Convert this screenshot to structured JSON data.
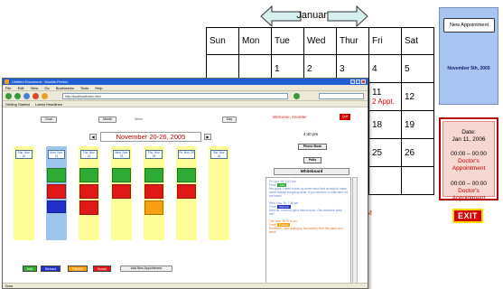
{
  "calendar": {
    "month": "January",
    "weekdays": [
      "Sun",
      "Mon",
      "Tue",
      "Wed",
      "Thur",
      "Fri",
      "Sat"
    ],
    "rows": [
      [
        "",
        "",
        "1",
        "2",
        "3",
        "4",
        "5"
      ],
      [
        "",
        "",
        "",
        "",
        "",
        "11",
        "12"
      ],
      [
        "",
        "",
        "",
        "",
        "",
        "18",
        "19"
      ],
      [
        "",
        "",
        "",
        "",
        "",
        "25",
        "26"
      ],
      [
        "",
        "",
        "",
        "",
        "",
        "",
        ""
      ]
    ],
    "appt_note": "2 Appt.",
    "cut_text": "M"
  },
  "panel_blue": {
    "new_appt_label": "New Appointment",
    "date": "November 5th, 2005"
  },
  "panel_red": {
    "date_label": "Date:",
    "date_value": "Jan 11, 2006",
    "appointments": [
      {
        "time": "00:00 – 00:00",
        "title": "Doctor's Appointment"
      },
      {
        "time": "00:00 – 00:00",
        "title": "Doctor's Appointment"
      }
    ]
  },
  "exit_label": "EXIT",
  "browser": {
    "title": "Untitled Document - Mozilla Firefox",
    "menu": [
      "File",
      "Edit",
      "View",
      "Go",
      "Bookmarks",
      "Tools",
      "Help"
    ],
    "url": "http://localhost/index.html",
    "bookmarks": [
      "Getting Started",
      "Latest Headlines"
    ],
    "status": "Done"
  },
  "app": {
    "top_buttons": [
      "Goal",
      "Month",
      "Week",
      "Day"
    ],
    "week_title": "November 20-26, 2005",
    "days": [
      {
        "label": "Sun, Nov. 20"
      },
      {
        "label": "Mon, Nov. 21"
      },
      {
        "label": "Tue, Nov. 22"
      },
      {
        "label": "Wed, Nov. 23"
      },
      {
        "label": "Thu, Nov. 24"
      },
      {
        "label": "Fri, Nov. 25"
      },
      {
        "label": "Sat, Nov. 26"
      }
    ],
    "legend": [
      {
        "name": "Julie",
        "color": "#2eaa35"
      },
      {
        "name": "Richard",
        "color": "#2030c8"
      },
      {
        "name": "Patricia",
        "color": "#f8a010"
      },
      {
        "name": "Susan",
        "color": "#e01818"
      }
    ],
    "add_label": "Add New Appointment",
    "welcome": "Welcome, Annette!",
    "logout": "Quit",
    "clock": "4:40 pm",
    "phone_book": "Phone Book",
    "polls": "Polls",
    "whiteboard": "Whiteboard",
    "notes": [
      {
        "head": "Fri, Nov. 18, 2:12 pm",
        "from": "Julie",
        "text": "Hey guys, I need to pick up some extra food at night to make some holiday shopping ideas. If you need me to walk later, let me know!"
      },
      {
        "head": "Wed, Nov. 16, 7:46 pm",
        "from": "Richard",
        "text": "Dear all: I need to get a haircut soon. Can someone drive me?"
      },
      {
        "head": "Tue, Nov. 15, 9:11 pm",
        "from": "Patricia",
        "text": "Reminder: I am picking up the laundry from the place next week."
      }
    ]
  }
}
